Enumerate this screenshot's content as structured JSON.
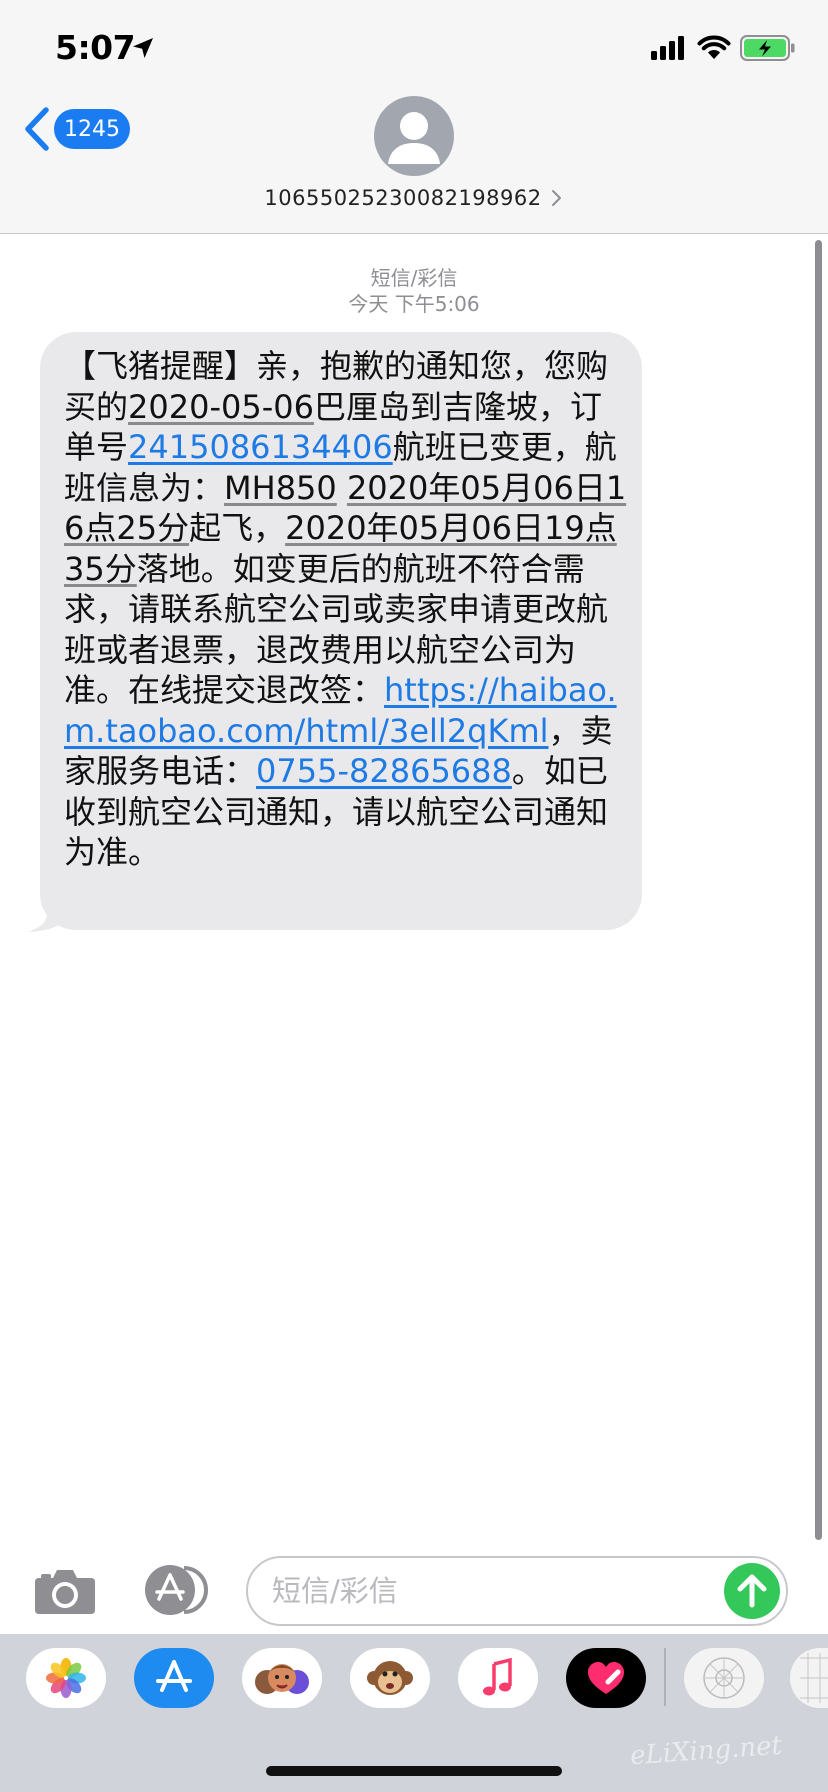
{
  "status_bar": {
    "time": "5:07",
    "icons": [
      "location-arrow-icon",
      "cellular-signal-icon",
      "wifi-icon",
      "battery-charging-icon"
    ],
    "battery_color": "#4cd964"
  },
  "header": {
    "back_badge": "1245",
    "contact_number": "10655025230082198962",
    "accent_color": "#1b7cf2"
  },
  "conversation": {
    "service_label": "短信/彩信",
    "timestamp": "今天 下午5:06",
    "message": {
      "segments": [
        {
          "t": "【飞猪提醒】亲，抱歉的通知您，您购买的"
        },
        {
          "t": "2020-05-06",
          "u": true
        },
        {
          "t": "巴厘岛到吉隆坡，订单号"
        },
        {
          "t": "2415086134406",
          "link": true
        },
        {
          "t": "航班已变更，航班信息为："
        },
        {
          "t": "MH850",
          "u": true
        },
        {
          "t": " "
        },
        {
          "t": "2020年05月06日16点25分",
          "u": true
        },
        {
          "t": "起飞，"
        },
        {
          "t": "2020年05月06日19点35分",
          "u": true
        },
        {
          "t": "落地。如变更后的航班不符合需求，请联系航空公司或卖家申请更改航班或者退票，退改费用以航空公司为准。在线提交退改签："
        },
        {
          "t": "https://haibao.m.taobao.com/html/3ell2qKml",
          "link": true
        },
        {
          "t": "，卖家服务电话："
        },
        {
          "t": "0755-82865688",
          "link": true
        },
        {
          "t": "。如已收到航空公司通知，请以航空公司通知为准。"
        }
      ]
    }
  },
  "input_bar": {
    "placeholder": "短信/彩信",
    "send_color": "#34c759"
  },
  "app_drawer": {
    "apps": [
      "photos-app-icon",
      "app-store-app-icon",
      "memoji-app-icon",
      "animoji-monkey-app-icon",
      "music-app-icon",
      "digital-touch-app-icon",
      "stickers-app-icon",
      "stickers-app-icon-2"
    ]
  },
  "watermark": "eLiXing.net"
}
